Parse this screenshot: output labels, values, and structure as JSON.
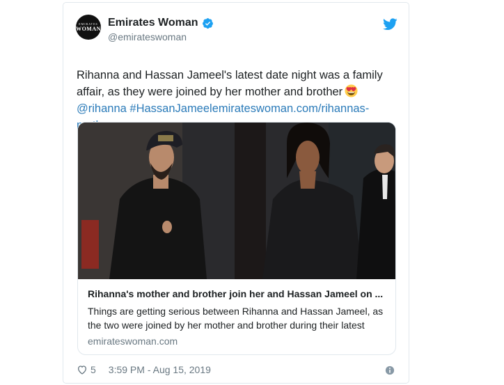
{
  "tweet": {
    "avatar_text_small": "EMIRATES",
    "avatar_text_big": "WOMAN",
    "display_name": "Emirates Woman",
    "handle": "@emirateswoman",
    "text_line1": "Rihanna and Hassan Jameel's latest date night was a family",
    "text_line2": "affair, as they were joined by her mother and brother",
    "mention": "@rihanna",
    "hashtag_link": "#HassanJameelemirateswoman.com/rihannas-mothe",
    "ellipsis": "…",
    "likes": "5",
    "timestamp": "3:59 PM - Aug 15, 2019"
  },
  "card": {
    "title": "Rihanna's mother and brother join her and Hassan Jameel on ...",
    "description": "Things are getting serious between Rihanna and Hassan Jameel, as the two were joined by her mother and brother during their latest",
    "domain": "emirateswoman.com",
    "cap_text": "JAMEEL"
  },
  "icons": {
    "verified": "verified-badge-icon",
    "twitter": "twitter-bird-icon",
    "emoji": "heart-eyes-emoji-icon",
    "heart": "heart-icon",
    "info": "info-icon"
  },
  "colors": {
    "link": "#2b7bb9",
    "verified": "#1da1f2",
    "muted": "#697882",
    "text": "#1c2022",
    "border": "#e1e8ed"
  }
}
